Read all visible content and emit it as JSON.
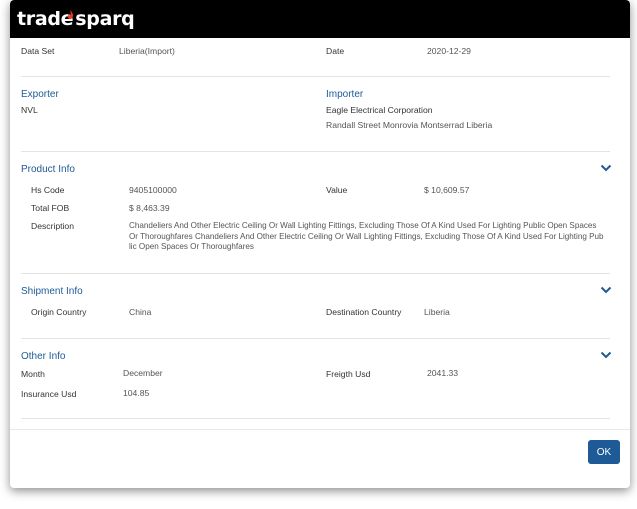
{
  "brand": {
    "logo_left": "trade",
    "logo_right": "sparq"
  },
  "header_fields": {
    "data_set_label": "Data Set",
    "data_set_value": "Liberia(Import)",
    "date_label": "Date",
    "date_value": "2020-12-29"
  },
  "parties": {
    "exporter_title": "Exporter",
    "exporter_name": "NVL",
    "importer_title": "Importer",
    "importer_name": "Eagle Electrical Corporation",
    "importer_address": "Randall Street Monrovia Montserrad Liberia"
  },
  "product_info": {
    "title": "Product Info",
    "hs_code_label": "Hs Code",
    "hs_code_value": "9405100000",
    "value_label": "Value",
    "value_value": "$ 10,609.57",
    "total_fob_label": "Total FOB",
    "total_fob_value": "$ 8,463.39",
    "description_label": "Description",
    "description_value": "Chandeliers And Other Electric Ceiling Or Wall Lighting Fittings, Excluding Those Of A Kind Used For Lighting Public Open Spaces Or Thoroughfares Chandeliers And Other Electric Ceiling Or Wall Lighting Fittings, Excluding Those Of A Kind Used For Lighting Public Open Spaces Or Thoroughfares"
  },
  "shipment_info": {
    "title": "Shipment Info",
    "origin_label": "Origin Country",
    "origin_value": "China",
    "destination_label": "Destination Country",
    "destination_value": "Liberia"
  },
  "other_info": {
    "title": "Other Info",
    "month_label": "Month",
    "month_value": "December",
    "freight_label": "Freigth Usd",
    "freight_value": "2041.33",
    "insurance_label": "Insurance Usd",
    "insurance_value": "104.85"
  },
  "footer": {
    "ok_label": "OK"
  },
  "colors": {
    "accent": "#1e5a96",
    "header_bg": "#000000",
    "flame": "#e63a1e"
  },
  "icons": [
    "flame-icon",
    "chevron-down-icon"
  ]
}
